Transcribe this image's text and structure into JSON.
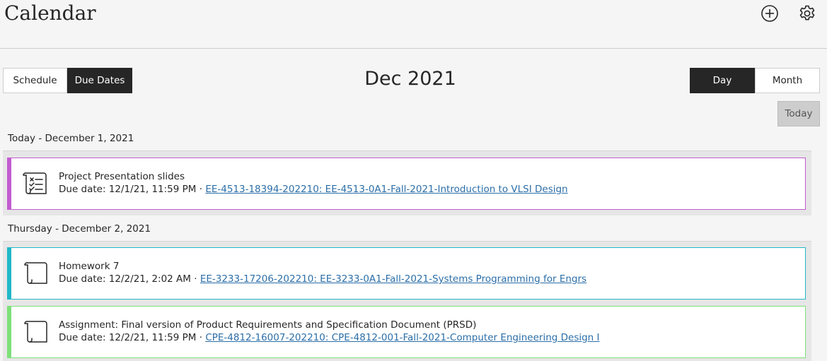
{
  "header": {
    "title": "Calendar",
    "add_icon": "add-circle-icon",
    "settings_icon": "gear-icon"
  },
  "view_toggle": {
    "schedule_label": "Schedule",
    "due_dates_label": "Due Dates",
    "active": "Due Dates"
  },
  "current_month": "Dec 2021",
  "range_toggle": {
    "day_label": "Day",
    "month_label": "Month",
    "active": "Day"
  },
  "today_button": "Today",
  "days": [
    {
      "header": "Today - December 1, 2021",
      "items": [
        {
          "title": "Project Presentation slides",
          "due_prefix": "Due date: 12/1/21, 11:59 PM · ",
          "course_link": "EE-4513-18394-202210: EE-4513-0A1-Fall-2021-Introduction to VLSI Design",
          "icon": "checklist-icon",
          "color": "#c35bd0"
        }
      ]
    },
    {
      "header": "Thursday - December 2, 2021",
      "items": [
        {
          "title": "Homework 7",
          "due_prefix": "Due date: 12/2/21, 2:02 AM · ",
          "course_link": "EE-3233-17206-202210: EE-3233-0A1-Fall-2021-Systems Programming for Engrs",
          "icon": "document-scroll-icon",
          "color": "#1fb8c9"
        },
        {
          "title": "Assignment: Final version of Product Requirements and Specification Document (PRSD)",
          "due_prefix": "Due date: 12/2/21, 11:59 PM · ",
          "course_link": "CPE-4812-16007-202210: CPE-4812-001-Fall-2021-Computer Engineering Design I",
          "icon": "document-scroll-icon",
          "color": "#7ee07a"
        }
      ]
    }
  ]
}
